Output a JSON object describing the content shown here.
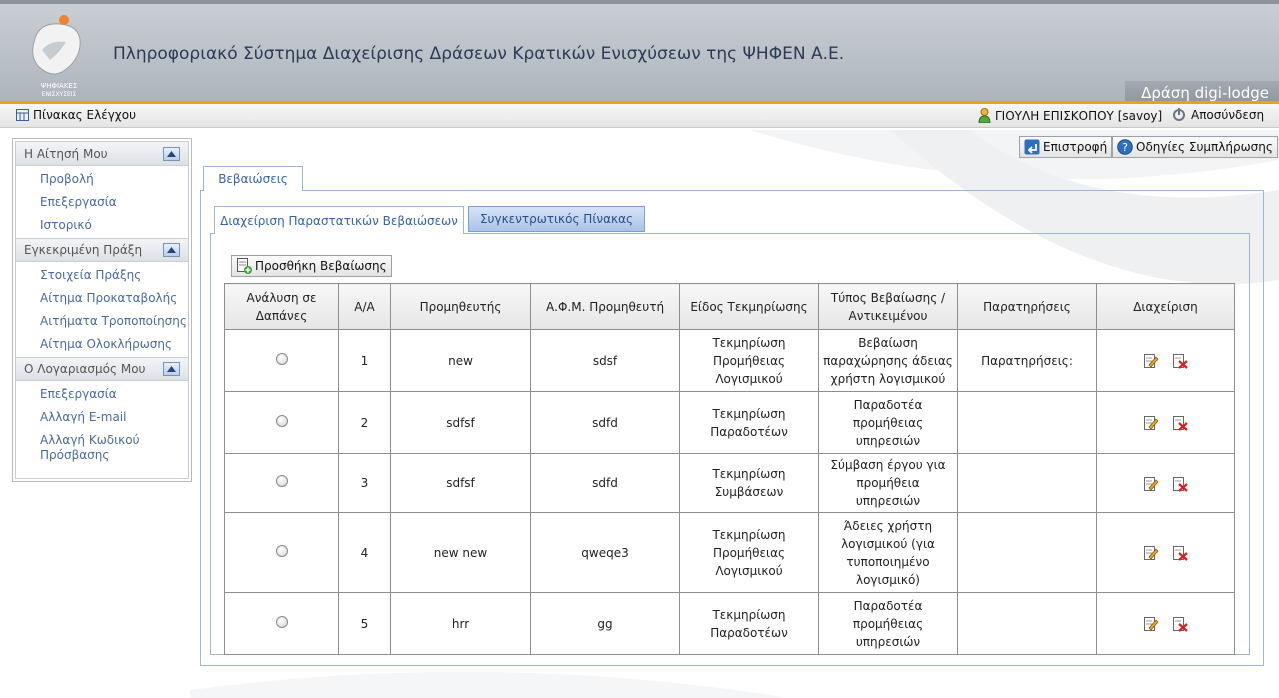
{
  "header": {
    "title": "Πληροφοριακό Σύστημα Διαχείρισης Δράσεων Κρατικών Ενισχύσεων της ΨΗΦΕΝ Α.Ε.",
    "logo_text_1": "ΨΗΦΙΑΚΕΣ",
    "logo_text_2": "ΕΝΙΣΧΥΣΕΙΣ",
    "action_name": "Δράση digi-lodge"
  },
  "topbar": {
    "dashboard": "Πίνακας Ελέγχου",
    "user": "ΓΙΟΥΛΗ ΕΠΙΣΚΟΠΟΥ [savoy]",
    "logout": "Αποσύνδεση"
  },
  "sidebar": {
    "sections": [
      {
        "title": "Η Αίτησή Μου",
        "items": [
          "Προβολή",
          "Επεξεργασία",
          "Ιστορικό"
        ]
      },
      {
        "title": "Εγκεκριμένη Πράξη",
        "items": [
          "Στοιχεία Πράξης",
          "Αίτημα Προκαταβολής",
          "Αιτήματα Τροποποίησης",
          "Αίτημα Ολοκλήρωσης"
        ]
      },
      {
        "title": "Ο Λογαριασμός Μου",
        "items": [
          "Επεξεργασία",
          "Αλλαγή E-mail",
          "Αλλαγή Κωδικού Πρόσβασης"
        ]
      }
    ]
  },
  "toolbar": {
    "back": "Επιστροφή",
    "guide": "Οδηγίες Συμπλήρωσης"
  },
  "tabs": {
    "main": "Βεβαιώσεις",
    "manage": "Διαχείριση Παραστατικών Βεβαιώσεων",
    "summary": "Συγκεντρωτικός Πίνακας"
  },
  "add_button": "Προσθήκη Βεβαίωσης",
  "table": {
    "headers": [
      "Ανάλυση σε Δαπάνες",
      "Α/Α",
      "Προμηθευτής",
      "Α.Φ.Μ. Προμηθευτή",
      "Είδος Τεκμηρίωσης",
      "Τύπος Βεβαίωσης / Αντικειμένου",
      "Παρατηρήσεις",
      "Διαχείριση"
    ],
    "rows": [
      {
        "aa": "1",
        "supplier": "new",
        "afm": "sdsf",
        "doc_type": "Τεκμηρίωση Προμήθειας Λογισμικού",
        "cert_type": "Βεβαίωση παραχώρησης άδειας χρήστη λογισμικού",
        "notes": "Παρατηρήσεις:"
      },
      {
        "aa": "2",
        "supplier": "sdfsf",
        "afm": "sdfd",
        "doc_type": "Τεκμηρίωση Παραδοτέων",
        "cert_type": "Παραδοτέα προμήθειας υπηρεσιών",
        "notes": ""
      },
      {
        "aa": "3",
        "supplier": "sdfsf",
        "afm": "sdfd",
        "doc_type": "Τεκμηρίωση Συμβάσεων",
        "cert_type": "Σύμβαση έργου για προμήθεια υπηρεσιών",
        "notes": ""
      },
      {
        "aa": "4",
        "supplier": "new new",
        "afm": "qweqe3",
        "doc_type": "Τεκμηρίωση Προμήθειας Λογισμικού",
        "cert_type": "Άδειες χρήστη λογισμικού (για τυποποιημένο λογισμικό)",
        "notes": ""
      },
      {
        "aa": "5",
        "supplier": "hrr",
        "afm": "gg",
        "doc_type": "Τεκμηρίωση Παραδοτέων",
        "cert_type": "Παραδοτέα προμήθειας υπηρεσιών",
        "notes": ""
      }
    ]
  }
}
